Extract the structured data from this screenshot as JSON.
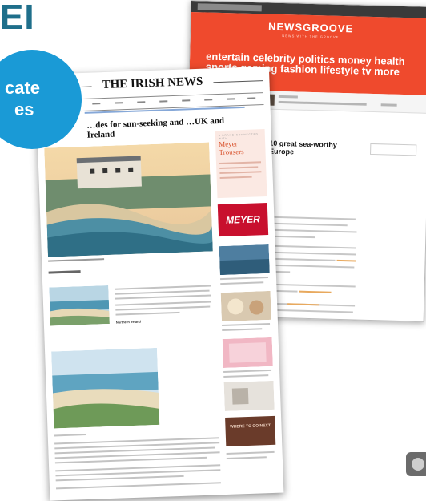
{
  "fragment_text": "EI",
  "back_page": {
    "logo": "NEWSGROOVE",
    "tagline": "NEWS WITH THE GROOVE",
    "nav": [
      "entertain",
      "celebrity",
      "politics",
      "money",
      "health",
      "sports",
      "gaming",
      "fashion",
      "lifestyle",
      "tv",
      "more"
    ],
    "article_title": "10 great sea-worthy Europe"
  },
  "front_page": {
    "masthead": "THE IRISH NEWS",
    "headline": "…des for sun-seeking and …UK and Ireland",
    "ad_kicker": "A BRAND CONNECTED WITH",
    "ad_name": "Meyer Trousers",
    "meyer_logo": "MEYER",
    "subheading": "Northern Ireland",
    "banner_text": "WHERE TO GO NEXT"
  },
  "badge": {
    "line1": "cate",
    "line2": "es"
  },
  "colors": {
    "newsgroove_red": "#ef4a2d",
    "badge_blue": "#1a9ad6",
    "meyer_red": "#c8102e",
    "fragment_teal": "#1f6f8b"
  }
}
